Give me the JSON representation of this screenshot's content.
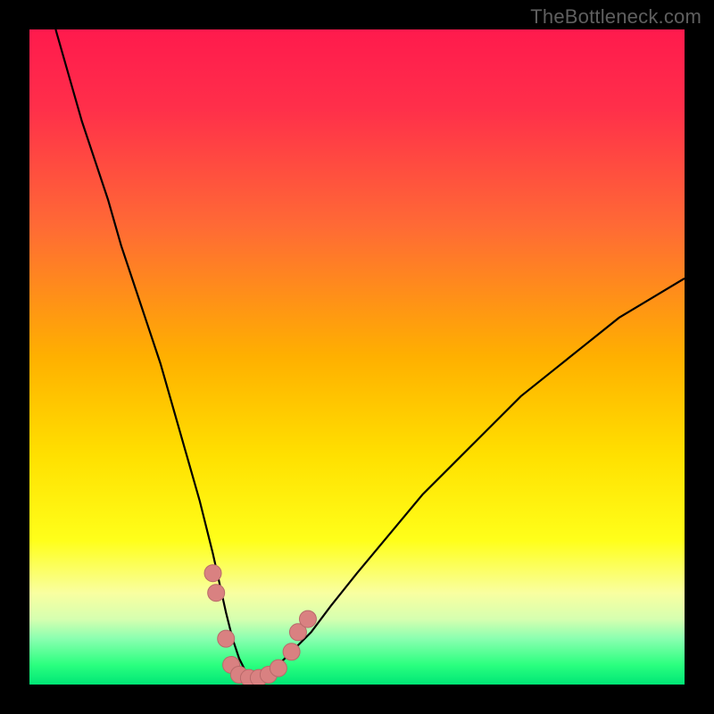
{
  "watermark": {
    "text": "TheBottleneck.com"
  },
  "chart_data": {
    "type": "line",
    "title": "",
    "xlabel": "",
    "ylabel": "",
    "xlim": [
      0,
      100
    ],
    "ylim": [
      0,
      100
    ],
    "grid": false,
    "legend": false,
    "background_gradient": {
      "type": "vertical",
      "stops": [
        {
          "offset": 0.0,
          "color": "#ff1a4d"
        },
        {
          "offset": 0.12,
          "color": "#ff2f4a"
        },
        {
          "offset": 0.3,
          "color": "#ff6a35"
        },
        {
          "offset": 0.5,
          "color": "#ffb000"
        },
        {
          "offset": 0.65,
          "color": "#ffe000"
        },
        {
          "offset": 0.78,
          "color": "#ffff1a"
        },
        {
          "offset": 0.86,
          "color": "#f9ffa0"
        },
        {
          "offset": 0.9,
          "color": "#d6ffb0"
        },
        {
          "offset": 0.93,
          "color": "#8affb0"
        },
        {
          "offset": 0.97,
          "color": "#2bff7f"
        },
        {
          "offset": 1.0,
          "color": "#00e676"
        }
      ]
    },
    "series": [
      {
        "name": "bottleneck-curve",
        "color": "#000000",
        "stroke_width": 2.2,
        "x": [
          4,
          6,
          8,
          10,
          12,
          14,
          16,
          18,
          20,
          22,
          24,
          26,
          28,
          30,
          31,
          32,
          33,
          34,
          35,
          37,
          40,
          43,
          46,
          50,
          55,
          60,
          65,
          70,
          75,
          80,
          85,
          90,
          95,
          100
        ],
        "y": [
          100,
          93,
          86,
          80,
          74,
          67,
          61,
          55,
          49,
          42,
          35,
          28,
          20,
          11,
          7,
          4,
          2,
          1,
          1,
          2,
          5,
          8,
          12,
          17,
          23,
          29,
          34,
          39,
          44,
          48,
          52,
          56,
          59,
          62
        ]
      }
    ],
    "markers": {
      "name": "sample-points",
      "color": "#d98181",
      "stroke": "#b86a6a",
      "radius": 9.5,
      "points": [
        {
          "x": 28.0,
          "y": 17
        },
        {
          "x": 28.5,
          "y": 14
        },
        {
          "x": 30.0,
          "y": 7
        },
        {
          "x": 30.8,
          "y": 3
        },
        {
          "x": 32.0,
          "y": 1.5
        },
        {
          "x": 33.5,
          "y": 1
        },
        {
          "x": 35.0,
          "y": 1
        },
        {
          "x": 36.5,
          "y": 1.5
        },
        {
          "x": 38.0,
          "y": 2.5
        },
        {
          "x": 40.0,
          "y": 5
        },
        {
          "x": 41.0,
          "y": 8
        },
        {
          "x": 42.5,
          "y": 10
        }
      ]
    }
  }
}
